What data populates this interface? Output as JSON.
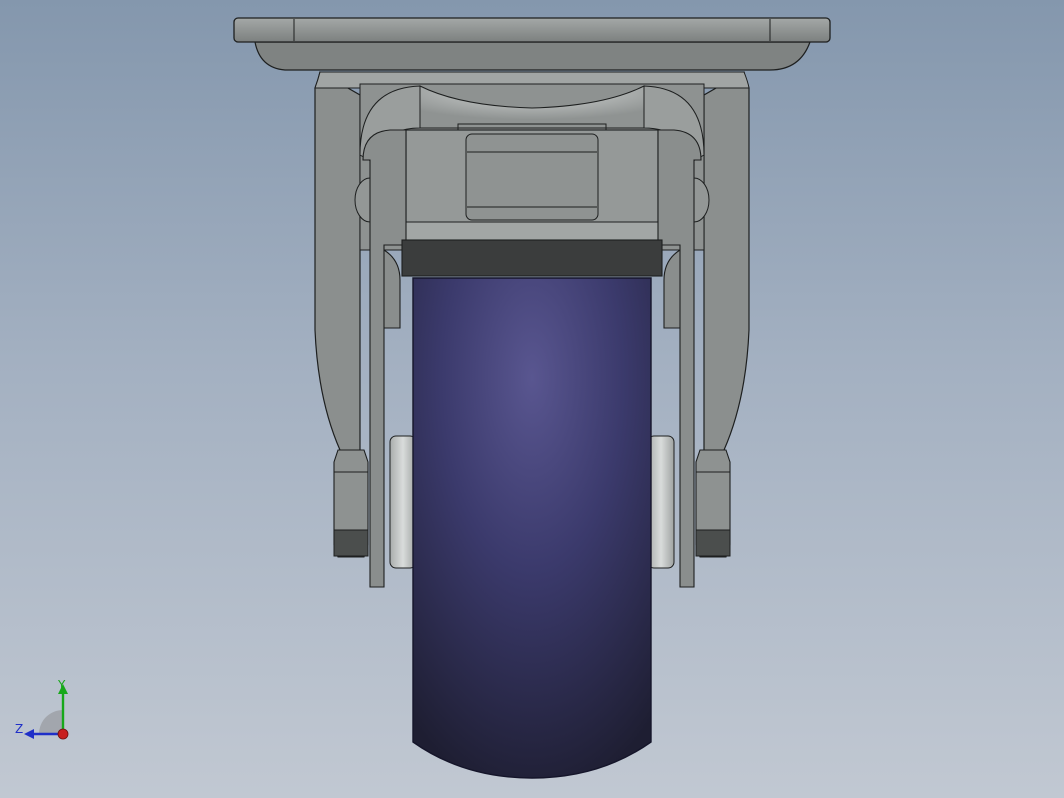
{
  "view": {
    "type": "cad-3d-viewport",
    "model": "swivel-caster-wheel",
    "projection": "front",
    "colors": {
      "background_top": "#8497ad",
      "background_bottom": "#c1c8d2",
      "metal": "#8d9190",
      "wheel": "#3f3d73",
      "edge": "#1d1f1f"
    }
  },
  "triad": {
    "y_label": "Y",
    "z_label": "Z",
    "y_color": "#17a81a",
    "z_color": "#1f2fc8",
    "x_color": "#c81f1f",
    "icons": [
      "y-axis-arrow-icon",
      "z-axis-arrow-icon",
      "x-axis-dot-icon"
    ]
  }
}
